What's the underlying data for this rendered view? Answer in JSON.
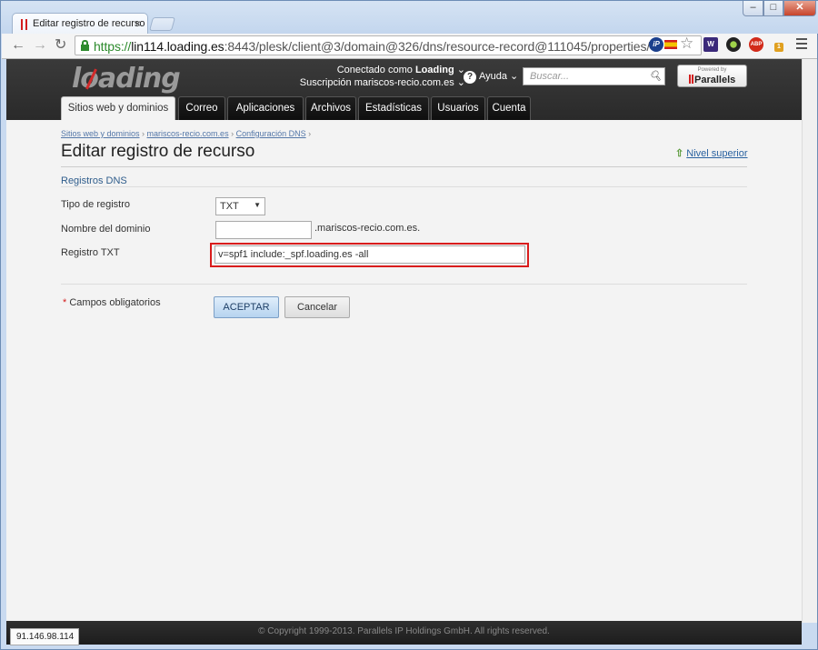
{
  "browser": {
    "tab_title": "Editar registro de recurso",
    "tab_close": "×",
    "window_controls": {
      "min": "–",
      "max": "□",
      "close": "✕"
    },
    "url_scheme": "https://",
    "url_host": "lin114.loading.es",
    "url_rest": ":8443/plesk/client@3/domain@326/dns/resource-record@111045/properties/",
    "nav_icons": [
      "back-arrow-icon",
      "forward-arrow-icon",
      "reload-icon"
    ],
    "extensions": [
      {
        "name": "ip-icon",
        "label": "iP",
        "color": "#1a3f8c"
      },
      {
        "name": "spain-flag-icon",
        "label": "",
        "color": "#d21d1d"
      },
      {
        "name": "star-icon",
        "label": "☆",
        "color": "#777777"
      },
      {
        "name": "extension-w-icon",
        "label": "W",
        "color": "#3b2a7a"
      },
      {
        "name": "extension-circle-icon",
        "label": "●",
        "color": "#222222"
      },
      {
        "name": "adblock-plus-icon",
        "label": "ABP",
        "color": "#d22b1a"
      },
      {
        "name": "extension-badge-icon",
        "label": "1",
        "color": "#e0a020"
      }
    ],
    "status_url": "91.146.98.114"
  },
  "header": {
    "logo_text": "loading",
    "connected_label": "Conectado como",
    "connected_user": "Loading",
    "subscription_label": "Suscripción",
    "subscription_value": "mariscos-recio.com.es",
    "help_label": "Ayuda",
    "search_placeholder": "Buscar...",
    "powered_by": "Powered by",
    "parallels": "Parallels"
  },
  "tabs": [
    {
      "label": "Sitios web y dominios",
      "active": true
    },
    {
      "label": "Correo",
      "active": false
    },
    {
      "label": "Aplicaciones",
      "active": false
    },
    {
      "label": "Archivos",
      "active": false
    },
    {
      "label": "Estadísticas",
      "active": false
    },
    {
      "label": "Usuarios",
      "active": false
    },
    {
      "label": "Cuenta",
      "active": false
    }
  ],
  "breadcrumb": [
    "Sitios web y dominios",
    "mariscos-recio.com.es",
    "Configuración DNS"
  ],
  "page": {
    "title": "Editar registro de recurso",
    "up_link": "Nivel superior",
    "section": "Registros DNS"
  },
  "form": {
    "record_type_label": "Tipo de registro",
    "record_type_value": "TXT",
    "domain_label": "Nombre del dominio",
    "domain_value": "",
    "domain_suffix": ".mariscos-recio.com.es.",
    "txt_label": "Registro TXT",
    "txt_value": "v=spf1 include:_spf.loading.es -all",
    "required_note": "Campos obligatorios",
    "required_marker": "*",
    "submit_label": "ACEPTAR",
    "cancel_label": "Cancelar"
  },
  "footer": {
    "copyright": "© Copyright 1999-2013. Parallels IP Holdings GmbH. All rights reserved."
  },
  "colors": {
    "header_bg": "#2f2f2f",
    "highlight": "#d91c1c",
    "link": "#2a62a0"
  }
}
